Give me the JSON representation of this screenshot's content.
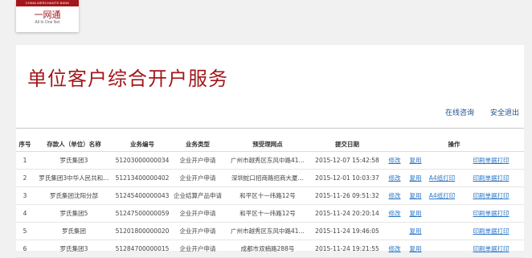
{
  "logo": {
    "bank_en": "CHINA MERCHANTS BANK",
    "name_cn": "一网通",
    "name_en": "All In One Net"
  },
  "page_title": "单位客户综合开户服务",
  "top_links": [
    "在线咨询",
    "安全退出"
  ],
  "table": {
    "headers": [
      "序号",
      "存款人（单位）名称",
      "业务编号",
      "业务类型",
      "预受理网点",
      "提交日期",
      "操作"
    ],
    "rows": [
      {
        "no": "1",
        "name": "罗氏集团3",
        "biz_no": "51203000000034",
        "type": "企业开户申请",
        "branch": "广州市越秀区东风中路41…",
        "date": "2015-12-07 15:42:58",
        "a1": "修改",
        "a2": "复用",
        "a3": "",
        "a4": "印刷单据打印"
      },
      {
        "no": "2",
        "name": "罗氏集团3中华人民共和…",
        "biz_no": "51213400000402",
        "type": "企业开户申请",
        "branch": "深圳蛇口招商路招商大厦…",
        "date": "2015-12-01 10:03:37",
        "a1": "修改",
        "a2": "复用",
        "a3": "A4纸打印",
        "a4": "印刷单据打印"
      },
      {
        "no": "3",
        "name": "罗氏集团沈阳分部",
        "biz_no": "51245400000043",
        "type": "企业结算产品申请",
        "branch": "和平区十一纬路12号",
        "date": "2015-11-26 09:51:32",
        "a1": "修改",
        "a2": "复用",
        "a3": "A4纸打印",
        "a4": "印刷单据打印"
      },
      {
        "no": "4",
        "name": "罗氏集团5",
        "biz_no": "51247500000059",
        "type": "企业开户申请",
        "branch": "和平区十一纬路12号",
        "date": "2015-11-24 20:20:14",
        "a1": "修改",
        "a2": "复用",
        "a3": "",
        "a4": "印刷单据打印"
      },
      {
        "no": "5",
        "name": "罗氏集团",
        "biz_no": "51201800000020",
        "type": "企业开户申请",
        "branch": "广州市越秀区东风中路41…",
        "date": "2015-11-24 19:46:05",
        "a1": "",
        "a2": "复用",
        "a3": "",
        "a4": "印刷单据打印"
      },
      {
        "no": "6",
        "name": "罗氏集团3",
        "biz_no": "51284700000015",
        "type": "企业开户申请",
        "branch": "成都市双楠路288号",
        "date": "2015-11-24 19:21:55",
        "a1": "修改",
        "a2": "复用",
        "a3": "",
        "a4": "印刷单据打印"
      }
    ]
  },
  "colors": {
    "brand": "#a3171b",
    "link": "#2a76c6"
  }
}
